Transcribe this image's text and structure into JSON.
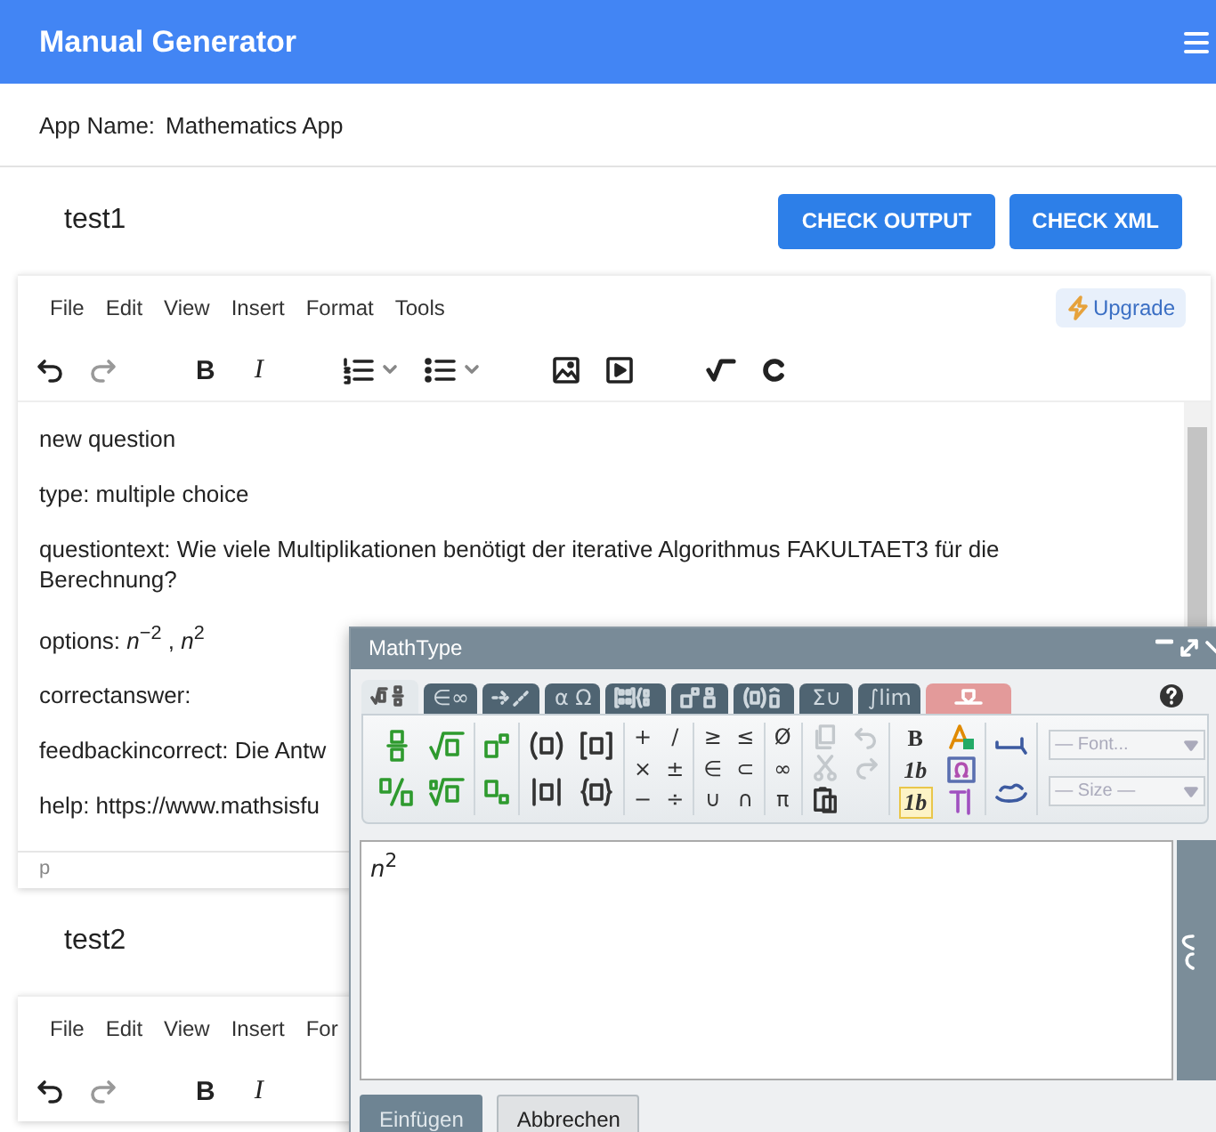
{
  "header": {
    "title": "Manual Generator"
  },
  "app_name": {
    "label": "App Name:",
    "value": "Mathematics App"
  },
  "sections": [
    {
      "title": "test1",
      "buttons": [
        "CHECK OUTPUT",
        "CHECK XML"
      ],
      "editor": {
        "menu": [
          "File",
          "Edit",
          "View",
          "Insert",
          "Format",
          "Tools"
        ],
        "upgrade": "Upgrade",
        "history": [
          {
            "disabled": false
          },
          {
            "disabled": true
          }
        ],
        "format_buttons": [
          "B",
          "I"
        ],
        "content": [
          "new question",
          "type: multiple choice",
          "questiontext: Wie viele Multiplikationen benötigt der iterative Algorithmus FAKULTAET3 für die Berechnung?",
          "options: *n*$^{−2}$ , *n*$^{2}$",
          "correctanswer:",
          "feedbackincorrect: Die Antw",
          "help: https://www.mathsisfu"
        ],
        "status": "p"
      }
    },
    {
      "title": "test2",
      "editor": {
        "menu": [
          "File",
          "Edit",
          "View",
          "Insert",
          "For"
        ],
        "history": [
          {
            "disabled": false
          },
          {
            "disabled": true
          }
        ],
        "format_buttons": [
          "B",
          "I"
        ]
      }
    }
  ],
  "mathtype": {
    "title": "MathType",
    "tabs": [
      {
        "kind": "icon",
        "selected": true
      },
      {
        "kind": "text",
        "label": "∈∞",
        "selected": false
      },
      {
        "kind": "icon",
        "selected": false
      },
      {
        "kind": "text",
        "label": "α Ω",
        "selected": false
      },
      {
        "kind": "icon",
        "selected": false
      },
      {
        "kind": "icon",
        "selected": false
      },
      {
        "kind": "icon",
        "selected": false
      },
      {
        "kind": "text",
        "label": "Σ∪",
        "selected": false
      },
      {
        "kind": "text",
        "label": "∫lim",
        "selected": false
      },
      {
        "kind": "special",
        "selected": false
      }
    ],
    "symbol_groups": [
      [
        "+",
        "/",
        "×",
        "±",
        "−",
        "÷"
      ],
      [
        "≥",
        "≤",
        "∈",
        "⊂",
        "∪",
        "∩"
      ],
      [
        "Ø",
        "∞",
        "π"
      ]
    ],
    "edit_tools": [
      {
        "disabled": true
      },
      {
        "disabled": true
      },
      {
        "disabled": true
      },
      {
        "disabled": true
      },
      {
        "disabled": false
      }
    ],
    "style_tools": [
      {
        "label": "B",
        "selected": false
      },
      {
        "label": "1b",
        "selected": false
      },
      {
        "label": "1b",
        "selected": true
      }
    ],
    "dropdowns": [
      {
        "label": "— Font...",
        "disabled": true
      },
      {
        "label": "— Size —",
        "disabled": true
      }
    ],
    "formula": "*n*$^{2}$",
    "buttons": [
      {
        "label": "Einfügen",
        "kind": "primary"
      },
      {
        "label": "Abbrechen",
        "kind": "secondary"
      }
    ]
  }
}
